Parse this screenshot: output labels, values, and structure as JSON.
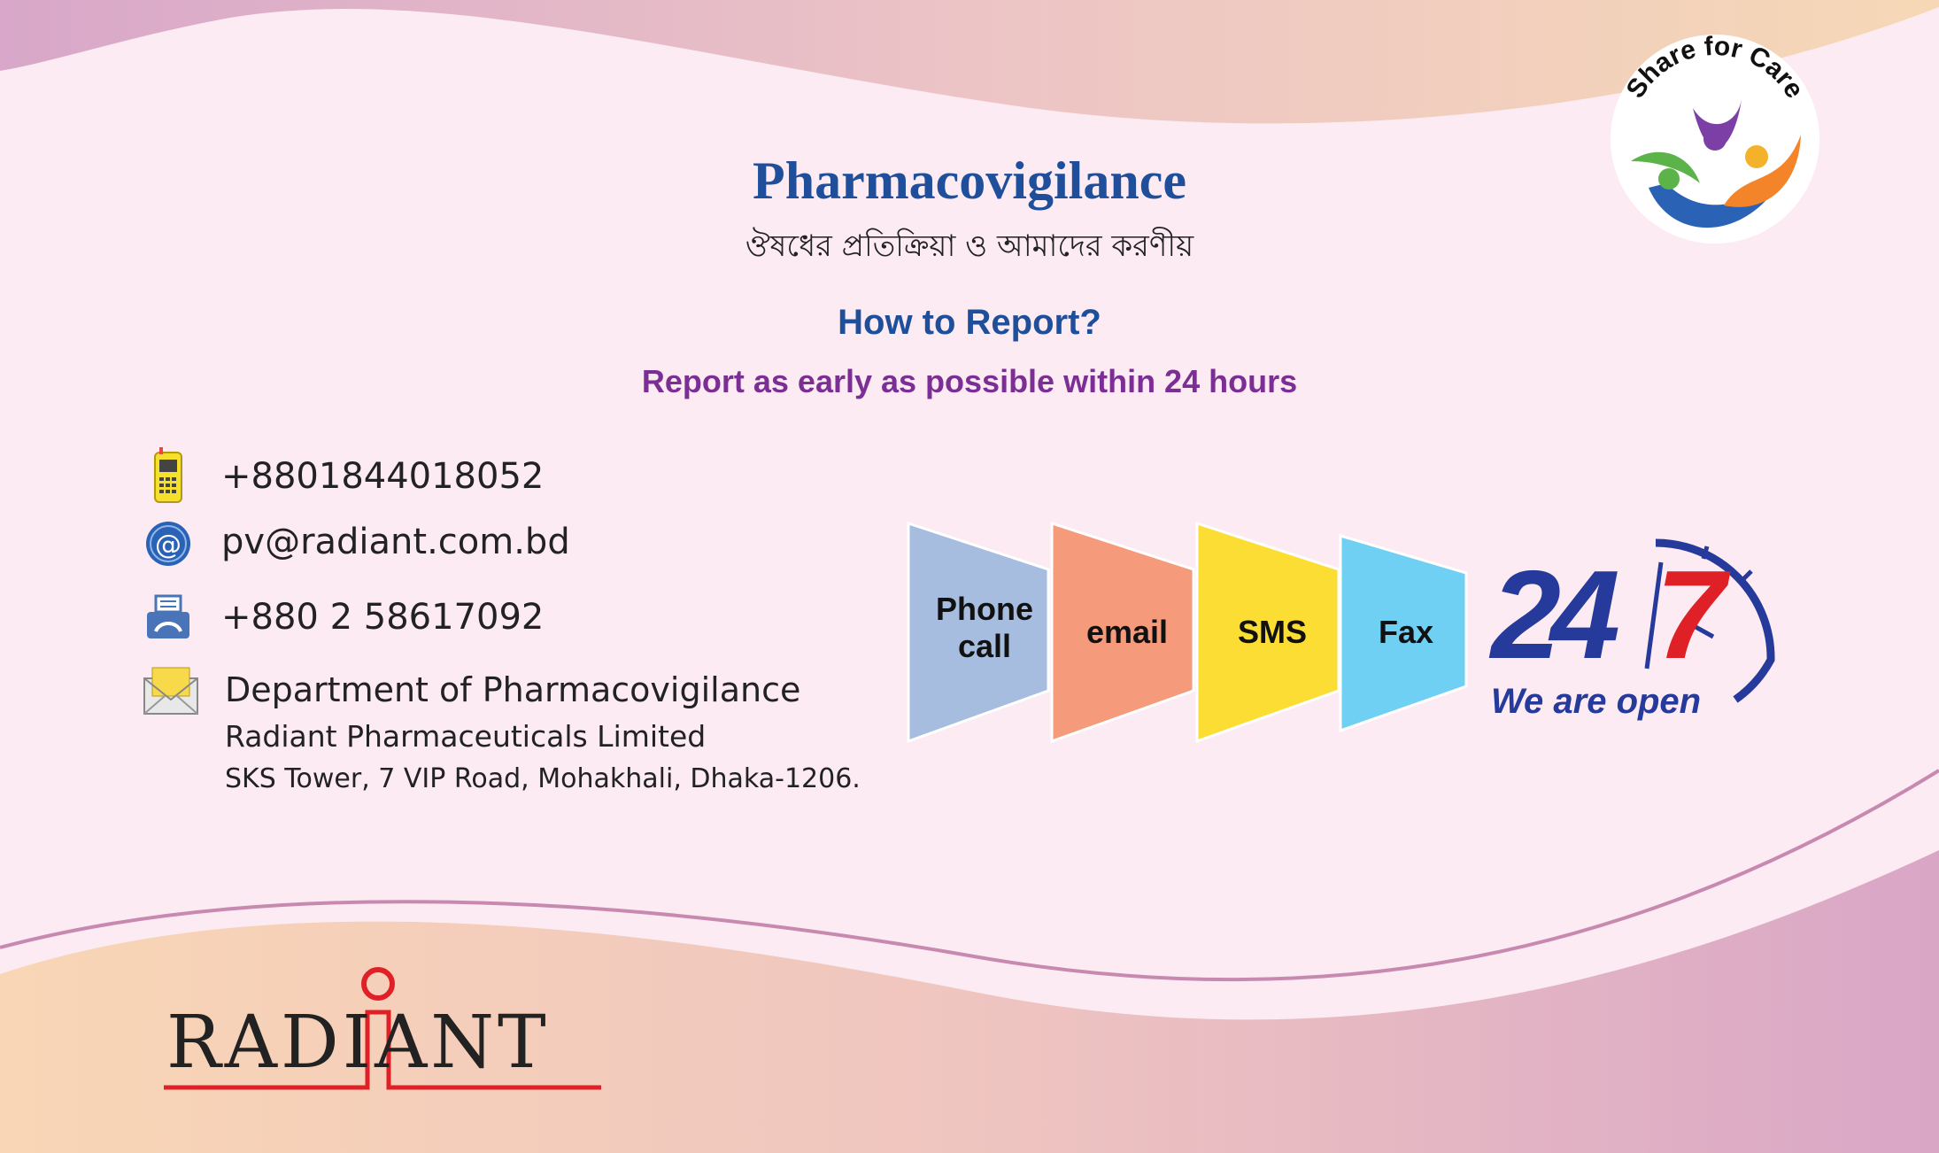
{
  "header": {
    "title": "Pharmacovigilance",
    "subtitle": "ঔষধের প্রতিক্রিয়া ও আমাদের করণীয়",
    "how_to": "How to Report?",
    "report_note": "Report as early as possible within 24 hours"
  },
  "contacts": {
    "phone": "+8801844018052",
    "email": "pv@radiant.com.bd",
    "fax": "+880 2 58617092",
    "address_line1": "Department of Pharmacovigilance",
    "address_line2": "Radiant Pharmaceuticals Limited",
    "address_line3": "SKS Tower, 7 VIP Road, Mohakhali, Dhaka-1206."
  },
  "channels": [
    {
      "label_line1": "Phone",
      "label_line2": "call",
      "color": "#a6bde0"
    },
    {
      "label_line1": "email",
      "label_line2": "",
      "color": "#f59a7b"
    },
    {
      "label_line1": "SMS",
      "label_line2": "",
      "color": "#fcdd34"
    },
    {
      "label_line1": "Fax",
      "label_line2": "",
      "color": "#6fd0f3"
    }
  ],
  "badge": {
    "text": "Share for Care"
  },
  "availability": {
    "hours": "24",
    "days": "7",
    "tagline": "We are open"
  },
  "brand": {
    "name": "RADIANT"
  },
  "colors": {
    "accent_blue": "#1f4e9a",
    "accent_purple": "#7b2e94",
    "brand_red": "#e02027"
  }
}
